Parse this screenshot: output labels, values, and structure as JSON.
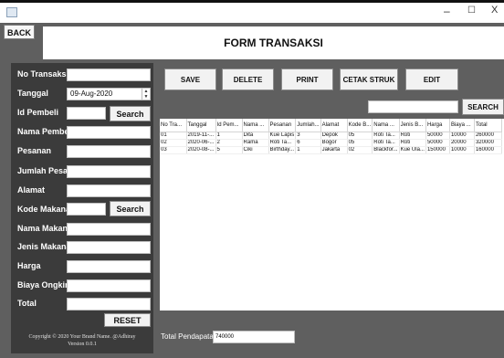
{
  "window": {
    "minimize": "–",
    "maximize": "☐",
    "close": "X"
  },
  "back_label": "BACK",
  "title": "FORM TRANSAKSI",
  "form": {
    "no_transaksi": {
      "label": "No Transaksi",
      "value": ""
    },
    "tanggal": {
      "label": "Tanggal",
      "value": "09-Aug-2020"
    },
    "id_pembeli": {
      "label": "Id Pembeli",
      "value": ""
    },
    "search1": "Search",
    "nama_pembeli": {
      "label": "Nama Pembeli",
      "value": ""
    },
    "pesanan": {
      "label": "Pesanan",
      "value": ""
    },
    "jumlah_pesanan": {
      "label": "Jumlah Pesanan",
      "value": ""
    },
    "alamat": {
      "label": "Alamat",
      "value": ""
    },
    "kode_makanan": {
      "label": "Kode Makanan",
      "value": ""
    },
    "search2": "Search",
    "nama_makanan": {
      "label": "Nama Makanan",
      "value": ""
    },
    "jenis_makanan": {
      "label": "Jenis Makanan",
      "value": ""
    },
    "harga": {
      "label": "Harga",
      "value": ""
    },
    "biaya_ongkir": {
      "label": "Biaya Ongkir",
      "value": ""
    },
    "total": {
      "label": "Total",
      "value": ""
    },
    "reset": "RESET"
  },
  "copyright": {
    "line1": "Copyright © 2020 Your Brand Name. @Adhiray",
    "line2": "Version 0.0.1"
  },
  "toolbar": {
    "save": "SAVE",
    "delete": "DELETE",
    "print": "PRINT",
    "cetak": "CETAK STRUK",
    "edit": "EDIT"
  },
  "search": {
    "value": "",
    "button": "SEARCH"
  },
  "table": {
    "headers": [
      "No Tra...",
      "Tanggal",
      "Id Pem...",
      "Nama ...",
      "Pesanan",
      "Jumlah...",
      "Alamat",
      "Kode B...",
      "Nama ...",
      "Jenis B...",
      "Harga",
      "Biaya ...",
      "Total"
    ],
    "rows": [
      [
        "01",
        "2019-11-...",
        "1",
        "Dita",
        "Kue Lapis",
        "3",
        "Depok",
        "05",
        "Roti Ta...",
        "Roti",
        "50000",
        "10000",
        "260000"
      ],
      [
        "02",
        "2020-06-...",
        "2",
        "Rama",
        "Roti Ta...",
        "6",
        "Bogor",
        "05",
        "Roti Ta...",
        "Roti",
        "50000",
        "20000",
        "320000"
      ],
      [
        "03",
        "2020-08-...",
        "5",
        "Ciki",
        "Birthday...",
        "1",
        "Jakarta",
        "02",
        "Blackfor...",
        "Kue Ula...",
        "150000",
        "10000",
        "160000"
      ]
    ]
  },
  "total_pendapatan": {
    "label": "Total Pendapatan",
    "value": "740000"
  }
}
